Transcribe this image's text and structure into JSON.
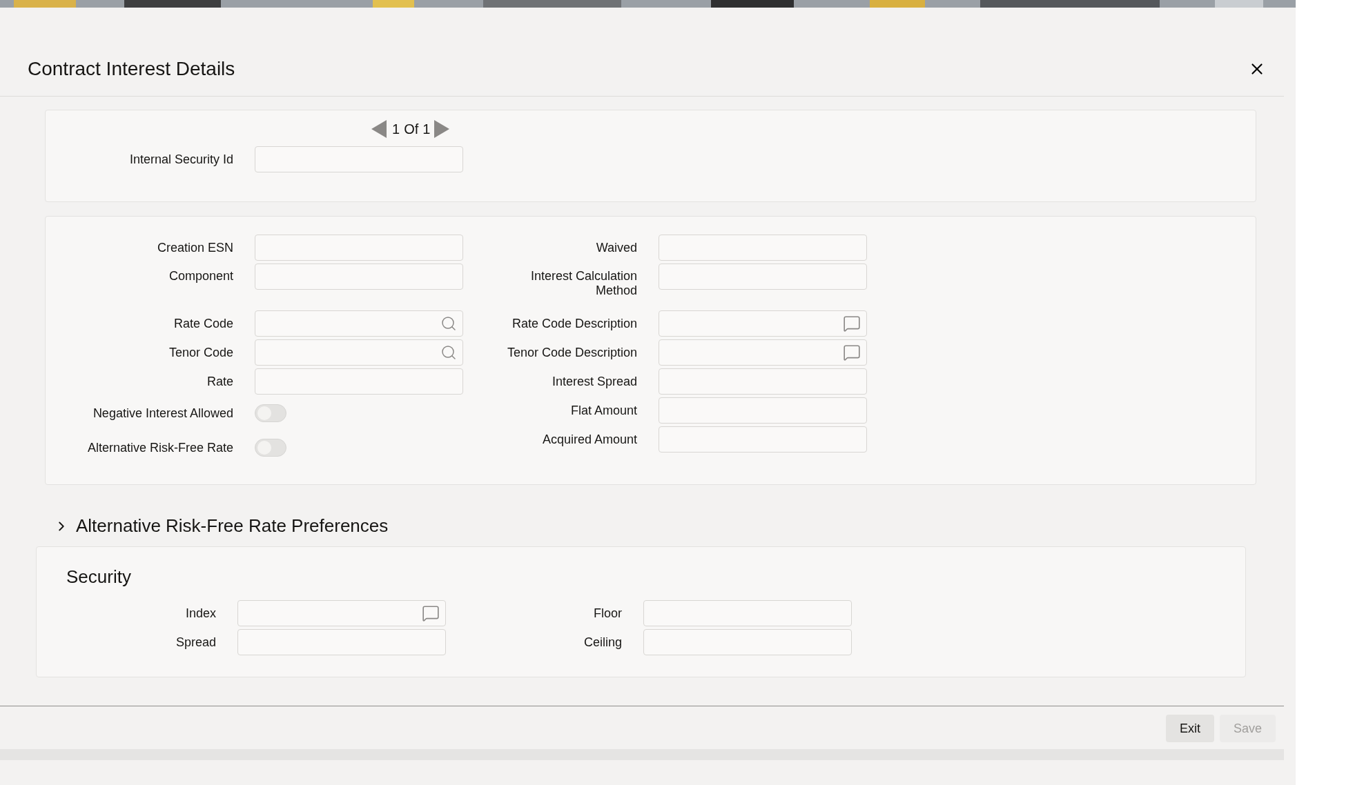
{
  "dialog": {
    "title": "Contract Interest Details"
  },
  "pagination": {
    "current": "1",
    "of": "Of",
    "total": "1"
  },
  "header_fields": [
    {
      "label": "Internal Security Id",
      "kind": "text"
    }
  ],
  "details": {
    "left": [
      {
        "label": "Creation ESN",
        "kind": "text"
      },
      {
        "label": "Component",
        "kind": "text"
      },
      {
        "label": "Rate Code",
        "kind": "search"
      },
      {
        "label": "Tenor Code",
        "kind": "search"
      },
      {
        "label": "Rate",
        "kind": "text"
      },
      {
        "label": "Negative Interest Allowed",
        "kind": "toggle",
        "on": false
      },
      {
        "label": "Alternative Risk-Free Rate",
        "kind": "toggle",
        "on": false
      }
    ],
    "right": [
      {
        "label": "Waived",
        "kind": "text"
      },
      {
        "label": "Interest Calculation Method",
        "kind": "text"
      },
      {
        "label": "Rate Code Description",
        "kind": "description"
      },
      {
        "label": "Tenor Code Description",
        "kind": "description"
      },
      {
        "label": "Interest Spread",
        "kind": "text"
      },
      {
        "label": "Flat Amount",
        "kind": "text"
      },
      {
        "label": "Acquired Amount",
        "kind": "text"
      }
    ]
  },
  "accordion": {
    "label": "Alternative Risk-Free Rate Preferences",
    "expanded": false
  },
  "security": {
    "title": "Security",
    "left": [
      {
        "label": "Index",
        "kind": "description"
      },
      {
        "label": "Spread",
        "kind": "text"
      }
    ],
    "right": [
      {
        "label": "Floor",
        "kind": "text"
      },
      {
        "label": "Ceiling",
        "kind": "text"
      }
    ]
  },
  "buttons": [
    {
      "label": "Exit",
      "disabled": false
    },
    {
      "label": "Save",
      "disabled": true
    }
  ]
}
